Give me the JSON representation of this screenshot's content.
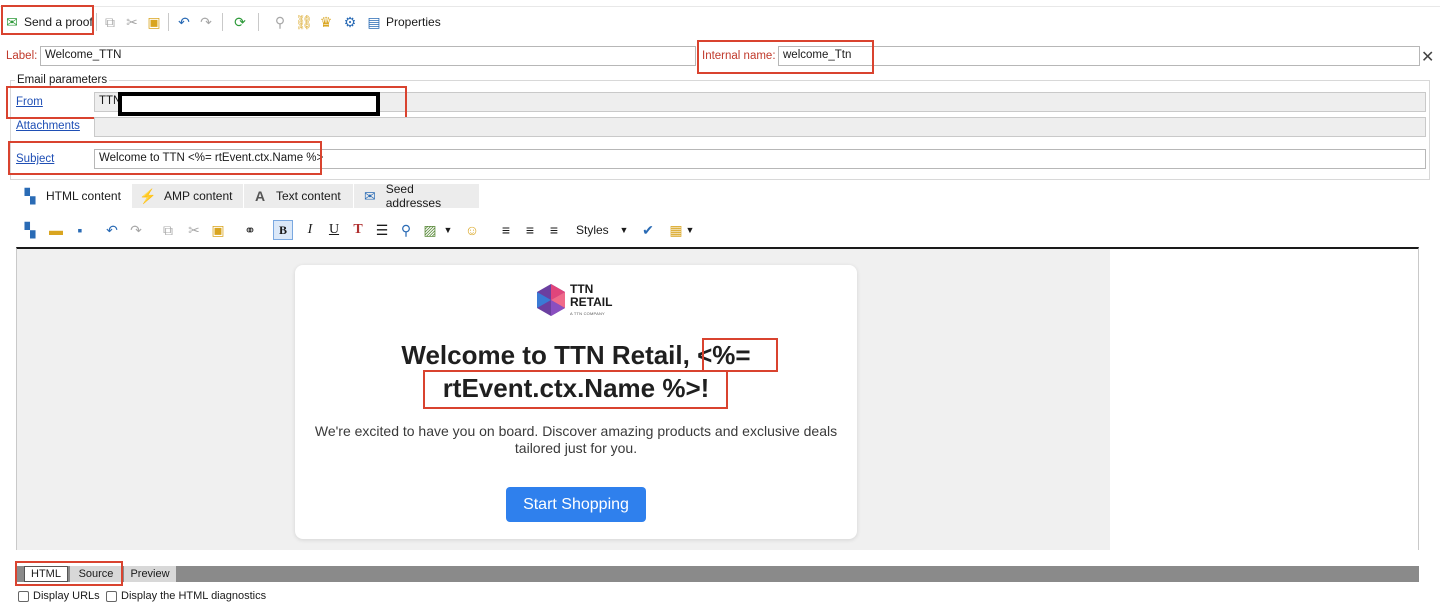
{
  "toolbar": {
    "send_proof": "Send a proof",
    "properties": "Properties"
  },
  "form": {
    "label_caption": "Label:",
    "label_value": "Welcome_TTN",
    "internal_caption": "Internal name:",
    "internal_value": "welcome_Ttn",
    "group_title": "Email parameters",
    "from_caption": "From",
    "from_value": "TTN",
    "attachments_caption": "Attachments",
    "subject_caption": "Subject",
    "subject_value": "Welcome to TTN <%= rtEvent.ctx.Name %>"
  },
  "tabs": {
    "html": "HTML content",
    "amp": "AMP content",
    "text": "Text content",
    "seed": "Seed addresses"
  },
  "editor": {
    "styles_label": "Styles"
  },
  "email": {
    "logo_line1": "TTN",
    "logo_line2": "RETAIL",
    "logo_sub": "A TTN COMPANY",
    "headline_part1": "Welcome to TTN Retail,",
    "headline_part2": "<%=",
    "headline_part3": "rtEvent.ctx.Name %>!",
    "paragraph": "We're excited to have you on board. Discover amazing products and exclusive deals tailored just for you.",
    "cta": "Start Shopping"
  },
  "bottom": {
    "tab_html": "HTML",
    "tab_source": "Source",
    "tab_preview": "Preview",
    "check_urls": "Display URLs",
    "check_diag": "Display the HTML diagnostics"
  },
  "colors": {
    "highlight": "#d9432f",
    "cta_bg": "#2f80ed",
    "link": "#1f4fb5"
  }
}
